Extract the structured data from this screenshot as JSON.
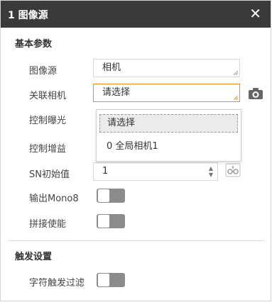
{
  "dialog": {
    "title": "1 图像源",
    "close_icon": "✕"
  },
  "section_basic": "基本参数",
  "section_trigger": "触发设置",
  "fields": {
    "image_source": {
      "label": "图像源",
      "value": "相机"
    },
    "linked_camera": {
      "label": "关联相机",
      "value": "请选择"
    },
    "control_exposure": {
      "label": "控制曝光"
    },
    "control_gain": {
      "label": "控制增益"
    },
    "sn_initial": {
      "label": "SN初始值",
      "value": "1"
    },
    "output_mono8": {
      "label": "输出Mono8",
      "on": false
    },
    "stitch_enable": {
      "label": "拼接使能",
      "on": false
    },
    "char_trigger_filter": {
      "label": "字符触发过滤",
      "on": false
    }
  },
  "dropdown": {
    "options": [
      "请选择",
      "0 全局相机1"
    ],
    "selected_index": 0
  },
  "colors": {
    "titlebar": "#3a3a3a",
    "accent": "#f08a24",
    "toggle_off": "#8c8c8c"
  }
}
